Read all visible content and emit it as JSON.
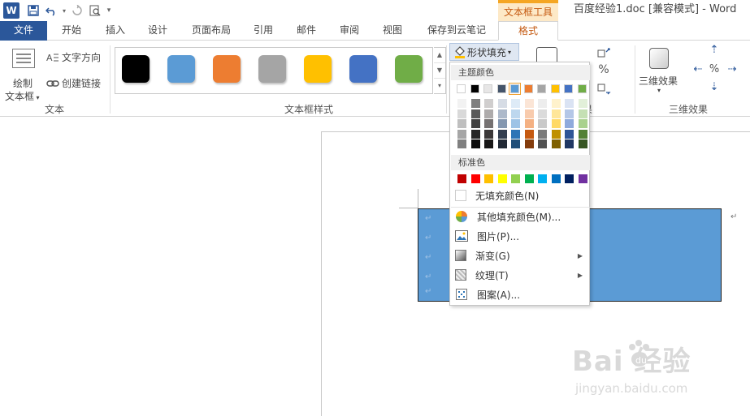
{
  "title_bar": {
    "app_badge": "W",
    "contextual_group": "文本框工具",
    "document_title": "百度经验1.doc [兼容模式] - Word"
  },
  "tabs": [
    {
      "label": "文件"
    },
    {
      "label": "开始"
    },
    {
      "label": "插入"
    },
    {
      "label": "设计"
    },
    {
      "label": "页面布局"
    },
    {
      "label": "引用"
    },
    {
      "label": "邮件"
    },
    {
      "label": "审阅"
    },
    {
      "label": "视图"
    },
    {
      "label": "保存到云笔记"
    },
    {
      "label": "格式"
    }
  ],
  "ribbon": {
    "text_group": {
      "draw_textbox_line1": "绘制",
      "draw_textbox_line2": "文本框",
      "text_direction": "文字方向",
      "create_link": "创建链接",
      "label": "文本"
    },
    "styles_group": {
      "label": "文本框样式",
      "swatches": [
        "#000000",
        "#5b9bd5",
        "#ed7d31",
        "#a5a5a5",
        "#ffc000",
        "#4472c4",
        "#70ad47"
      ]
    },
    "shape_fill_label": "形状填充",
    "effects_group": {
      "effects_label": "三维效果",
      "group_label": "三维效果",
      "partial_label": "果"
    }
  },
  "fill_menu": {
    "theme_colors_header": "主题颜色",
    "standard_colors_header": "标准色",
    "theme_top_row": [
      "#ffffff",
      "#000000",
      "#e7e6e6",
      "#44546a",
      "#5b9bd5",
      "#ed7d31",
      "#a5a5a5",
      "#ffc000",
      "#4472c4",
      "#70ad47"
    ],
    "theme_tints": [
      [
        "#f2f2f2",
        "#7f7f7f",
        "#d0cece",
        "#d6dce5",
        "#deebf7",
        "#fbe5d6",
        "#ededed",
        "#fff2cc",
        "#dae3f3",
        "#e2f0d9"
      ],
      [
        "#d9d9d9",
        "#595959",
        "#aeabab",
        "#adb9ca",
        "#bdd7ee",
        "#f8cbad",
        "#dbdbdb",
        "#ffe699",
        "#b4c7e7",
        "#c5e0b4"
      ],
      [
        "#bfbfbf",
        "#404040",
        "#757171",
        "#8497b0",
        "#9dc3e6",
        "#f4b183",
        "#c9c9c9",
        "#ffd966",
        "#8faadc",
        "#a9d18e"
      ],
      [
        "#a6a6a6",
        "#262626",
        "#3b3838",
        "#333f50",
        "#2e75b6",
        "#c55a11",
        "#7b7b7b",
        "#bf9000",
        "#2f5597",
        "#538135"
      ],
      [
        "#808080",
        "#0d0d0d",
        "#181717",
        "#222a35",
        "#1f4e79",
        "#843c0c",
        "#525252",
        "#7f6000",
        "#203864",
        "#375623"
      ]
    ],
    "standard_row": [
      "#c00000",
      "#ff0000",
      "#ffc000",
      "#ffff00",
      "#92d050",
      "#00b050",
      "#00b0f0",
      "#0070c0",
      "#002060",
      "#7030a0"
    ],
    "no_fill": "无填充颜色(N)",
    "more_colors": "其他填充颜色(M)...",
    "picture": "图片(P)...",
    "gradient": "渐变(G)",
    "texture": "纹理(T)",
    "pattern": "图案(A)..."
  },
  "document": {
    "paragraph_mark": "↵"
  },
  "watermark": {
    "brand": "Bai  经验",
    "url": "jingyan.baidu.com"
  }
}
